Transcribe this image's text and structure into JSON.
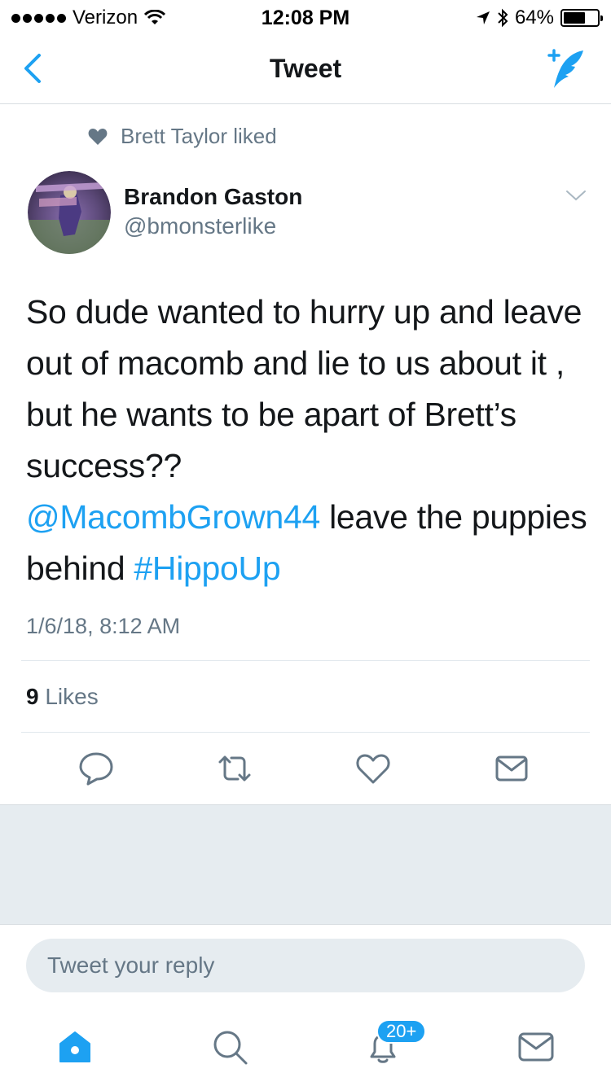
{
  "status_bar": {
    "carrier": "Verizon",
    "time": "12:08 PM",
    "battery_text": "64%",
    "battery_level": 0.64
  },
  "nav": {
    "title": "Tweet",
    "back_icon": "chevron-left-icon",
    "compose_icon": "compose-tweet-icon"
  },
  "social_context": {
    "text": "Brett Taylor liked",
    "icon": "heart-icon"
  },
  "tweet": {
    "author": {
      "name": "Brandon Gaston",
      "handle": "@bmonsterlike"
    },
    "text_part1": "So dude wanted to hurry up and leave out of macomb and lie to us about it , but he wants to be apart of Brett’s success??",
    "mention": "@MacombGrown44",
    "text_part2": " leave the puppies behind ",
    "hashtag": "#HippoUp",
    "timestamp": "1/6/18, 8:12 AM",
    "likes_count": "9",
    "likes_label": "Likes"
  },
  "reply": {
    "placeholder": "Tweet your reply"
  },
  "tab_bar": {
    "items": [
      "home-icon",
      "search-icon",
      "notifications-icon",
      "messages-icon"
    ],
    "notification_badge": "20+"
  },
  "colors": {
    "accent": "#1da1f2",
    "secondary_text": "#657786",
    "primary_text": "#14171a",
    "background_gray": "#e6ecf0"
  }
}
